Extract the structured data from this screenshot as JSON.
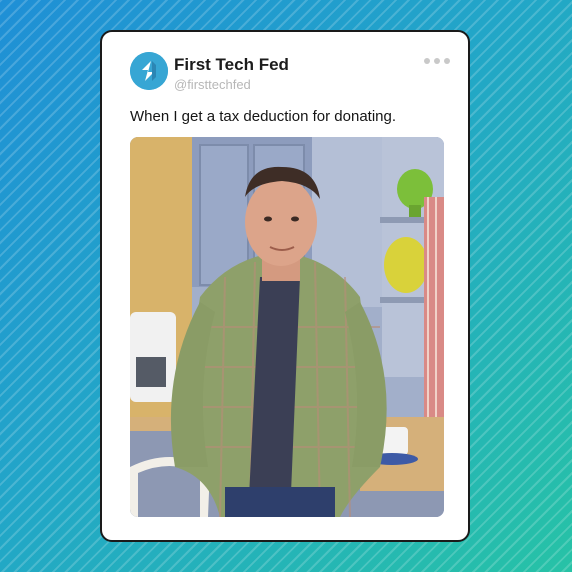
{
  "post": {
    "account_name": "First Tech Fed",
    "handle": "@firsttechfed",
    "caption": "When I get a tax deduction for donating.",
    "avatar_icon": "first-tech-logo-icon",
    "menu_icon": "more-options-icon"
  },
  "colors": {
    "background_start": "#1f8fd6",
    "background_end": "#27c2a6",
    "logo": "#37a6d4"
  }
}
